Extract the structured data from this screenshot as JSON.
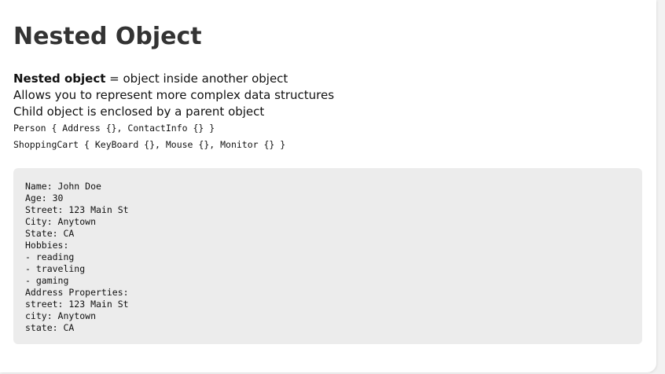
{
  "page": {
    "title": "Nested Object"
  },
  "intro": {
    "definition_term": "Nested object",
    "definition_rest": " = object inside another object",
    "line2": "Allows you to represent more complex data structures",
    "line3": "Child object is enclosed by a parent object",
    "example1": "Person { Address {}, ContactInfo {} }",
    "example2": "ShoppingCart { KeyBoard {}, Mouse {}, Monitor {} }"
  },
  "output": {
    "lines": [
      "Name: John Doe",
      "Age: 30",
      "Street: 123 Main St",
      "City: Anytown",
      "State: CA",
      "Hobbies:",
      "- reading",
      "- traveling",
      "- gaming",
      "Address Properties:",
      "street: 123 Main St",
      "city: Anytown",
      "state: CA"
    ]
  }
}
